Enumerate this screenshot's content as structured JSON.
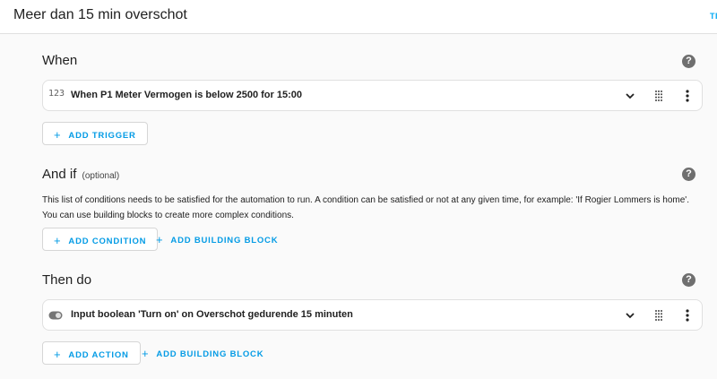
{
  "header": {
    "title": "Meer dan 15 min overschot",
    "corner_link": "TI"
  },
  "when": {
    "title": "When",
    "trigger_icon": "numeric-123-icon",
    "trigger_label": "When P1 Meter Vermogen is below 2500 for 15:00",
    "add_trigger": "ADD TRIGGER"
  },
  "and_if": {
    "title": "And if",
    "optional": "(optional)",
    "description_line1": "This list of conditions needs to be satisfied for the automation to run. A condition can be satisfied or not at any given time, for example: 'If Rogier Lommers is home'.",
    "description_line2": "You can use building blocks to create more complex conditions.",
    "add_condition": "ADD CONDITION",
    "add_building_block": "ADD BUILDING BLOCK"
  },
  "then_do": {
    "title": "Then do",
    "action_icon": "toggle-switch-icon",
    "action_label": "Input boolean 'Turn on' on Overschot gedurende 15 minuten",
    "add_action": "ADD ACTION",
    "add_building_block": "ADD BUILDING BLOCK"
  },
  "icons": {
    "help": "?",
    "plus": "+",
    "numeric": "123"
  },
  "colors": {
    "accent": "#039be5",
    "help_icon": "#6f6f6f",
    "background": "#fafafa"
  }
}
